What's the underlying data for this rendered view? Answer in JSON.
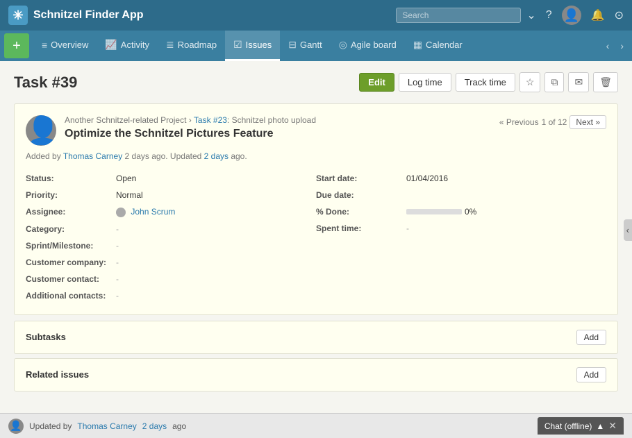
{
  "app": {
    "name": "Schnitzel Finder App"
  },
  "top_nav": {
    "search_placeholder": "Search",
    "icons": [
      "search",
      "chevron-down",
      "help",
      "avatar",
      "bell",
      "clock"
    ]
  },
  "sec_nav": {
    "add_label": "+",
    "items": [
      {
        "label": "Overview",
        "icon": "≡",
        "active": false
      },
      {
        "label": "Activity",
        "icon": "♡",
        "active": false
      },
      {
        "label": "Roadmap",
        "icon": "≣",
        "active": false
      },
      {
        "label": "Issues",
        "icon": "✓",
        "active": true
      },
      {
        "label": "Gantt",
        "icon": "—",
        "active": false
      },
      {
        "label": "Agile board",
        "icon": "◎",
        "active": false
      },
      {
        "label": "Calendar",
        "icon": "▦",
        "active": false
      }
    ]
  },
  "task": {
    "id": "Task #39",
    "buttons": {
      "edit": "Edit",
      "log_time": "Log time",
      "track_time": "Track time"
    },
    "breadcrumb_project": "Another Schnitzel-related Project",
    "breadcrumb_task_ref": "Task #23",
    "breadcrumb_task_name": "Schnitzel photo upload",
    "title": "Optimize the Schnitzel Pictures Feature",
    "added_by": "Thomas Carney",
    "added_time": "2 days",
    "updated_time": "2 days",
    "navigation": {
      "prev": "« Previous",
      "page": "1 of 12",
      "next": "Next »"
    },
    "fields": {
      "status_label": "Status:",
      "status_value": "Open",
      "priority_label": "Priority:",
      "priority_value": "Normal",
      "assignee_label": "Assignee:",
      "assignee_value": "John Scrum",
      "category_label": "Category:",
      "category_value": "-",
      "sprint_label": "Sprint/Milestone:",
      "sprint_value": "-",
      "customer_company_label": "Customer company:",
      "customer_company_value": "-",
      "customer_contact_label": "Customer contact:",
      "customer_contact_value": "-",
      "additional_contacts_label": "Additional contacts:",
      "additional_contacts_value": "-",
      "start_date_label": "Start date:",
      "start_date_value": "01/04/2016",
      "due_date_label": "Due date:",
      "due_date_value": "",
      "percent_done_label": "% Done:",
      "percent_done_value": "0%",
      "spent_time_label": "Spent time:",
      "spent_time_value": "-"
    },
    "subtasks": {
      "title": "Subtasks",
      "add_label": "Add"
    },
    "related_issues": {
      "title": "Related issues",
      "add_label": "Add"
    }
  },
  "bottom_bar": {
    "text": "Updated by",
    "user": "Thomas Carney",
    "time": "2 days",
    "suffix": "ago",
    "chat_label": "Chat (offline)",
    "chat_expand": "▲",
    "chat_close": "✕"
  }
}
